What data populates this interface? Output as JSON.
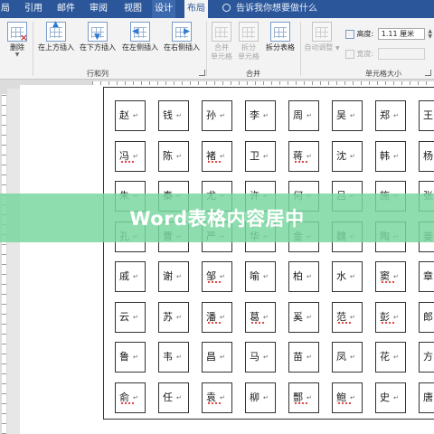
{
  "tabs": {
    "file_partial": "局",
    "references": "引用",
    "mailings": "邮件",
    "review": "审阅",
    "view": "视图",
    "design": "设计",
    "layout": "布局"
  },
  "tell_me": "告诉我你想要做什么",
  "ribbon": {
    "delete": "删除",
    "insert_above": "在上方插入",
    "insert_below": "在下方插入",
    "insert_left": "在左侧插入",
    "insert_right": "在右侧插入",
    "rows_cols_group": "行和列",
    "merge_cells_line1": "合并",
    "merge_cells_line2": "单元格",
    "split_cells_line1": "拆分",
    "split_cells_line2": "单元格",
    "split_table": "拆分表格",
    "merge_group": "合并",
    "autofit": "自动调整",
    "height_label": "高度:",
    "height_value": "1.11 厘米",
    "width_label": "宽度:",
    "cell_size_group": "单元格大小"
  },
  "table": {
    "paragraph_mark": "↵",
    "rows": [
      [
        "赵",
        "钱",
        "孙",
        "李",
        "周",
        "吴",
        "郑",
        "王"
      ],
      [
        "冯",
        "陈",
        "褚",
        "卫",
        "蒋",
        "沈",
        "韩",
        "杨"
      ],
      [
        "朱",
        "秦",
        "尤",
        "许",
        "何",
        "吕",
        "施",
        "张"
      ],
      [
        "孔",
        "曹",
        "严",
        "华",
        "金",
        "魏",
        "陶",
        "姜"
      ],
      [
        "戚",
        "谢",
        "邹",
        "喻",
        "柏",
        "水",
        "窦",
        "章"
      ],
      [
        "云",
        "苏",
        "潘",
        "葛",
        "奚",
        "范",
        "彭",
        "郎"
      ],
      [
        "鲁",
        "韦",
        "昌",
        "马",
        "苗",
        "凤",
        "花",
        "方"
      ],
      [
        "俞",
        "任",
        "袁",
        "柳",
        "酆",
        "鲍",
        "史",
        "唐"
      ]
    ],
    "spellcheck": [
      [
        0,
        0,
        0,
        0,
        0,
        0,
        0,
        0
      ],
      [
        1,
        0,
        1,
        0,
        1,
        0,
        0,
        0
      ],
      [
        0,
        0,
        0,
        0,
        0,
        0,
        0,
        0
      ],
      [
        0,
        0,
        0,
        0,
        0,
        0,
        0,
        0
      ],
      [
        0,
        0,
        1,
        0,
        0,
        0,
        1,
        0
      ],
      [
        0,
        0,
        1,
        1,
        0,
        1,
        1,
        0
      ],
      [
        0,
        0,
        0,
        0,
        0,
        0,
        0,
        0
      ],
      [
        1,
        0,
        1,
        0,
        1,
        1,
        0,
        0
      ]
    ]
  },
  "banner": {
    "title": "Word表格内容居中"
  }
}
